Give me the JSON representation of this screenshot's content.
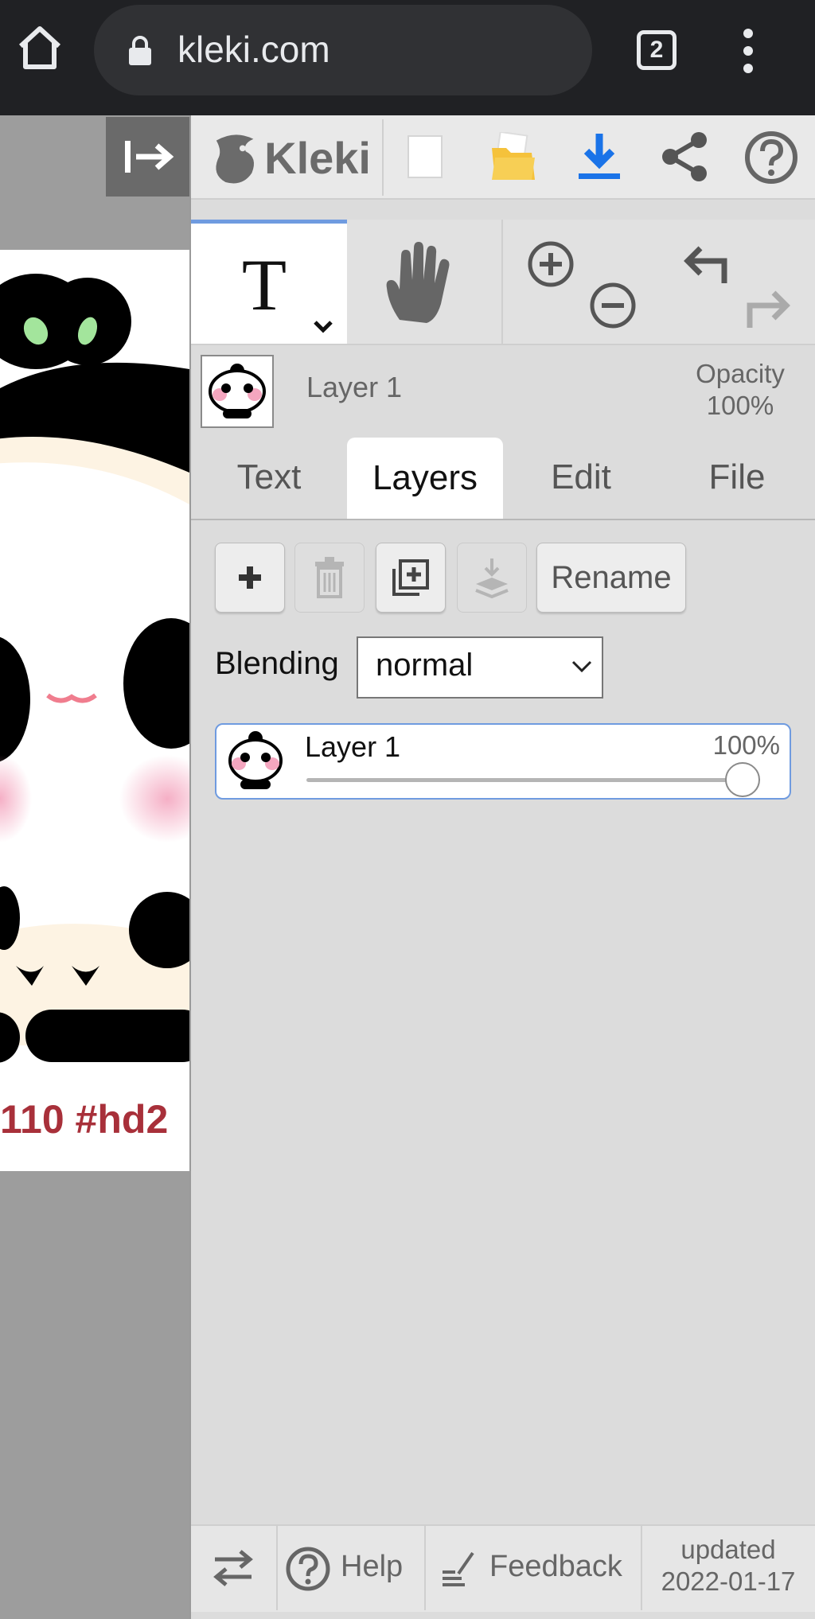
{
  "browser": {
    "url": "kleki.com",
    "tab_count": "2"
  },
  "canvas": {
    "caption": "110 #hd2"
  },
  "app": {
    "logo": "Kleki"
  },
  "layer_info": {
    "name": "Layer 1",
    "opacity_label": "Opacity",
    "opacity_value": "100%"
  },
  "tabs": [
    {
      "label": "Text",
      "active": false
    },
    {
      "label": "Layers",
      "active": true
    },
    {
      "label": "Edit",
      "active": false
    },
    {
      "label": "File",
      "active": false
    }
  ],
  "layers_panel": {
    "rename_label": "Rename",
    "blending_label": "Blending",
    "blending_value": "normal",
    "layers": [
      {
        "name": "Layer 1",
        "opacity": "100%",
        "opacity_fraction": 1.0
      }
    ]
  },
  "bottom": {
    "help": "Help",
    "feedback": "Feedback",
    "updated_label": "updated",
    "updated_date": "2022-01-17"
  },
  "colors": {
    "accent": "#6f9be0",
    "download_blue": "#1a73e8",
    "folder_yellow": "#f5c23b"
  }
}
